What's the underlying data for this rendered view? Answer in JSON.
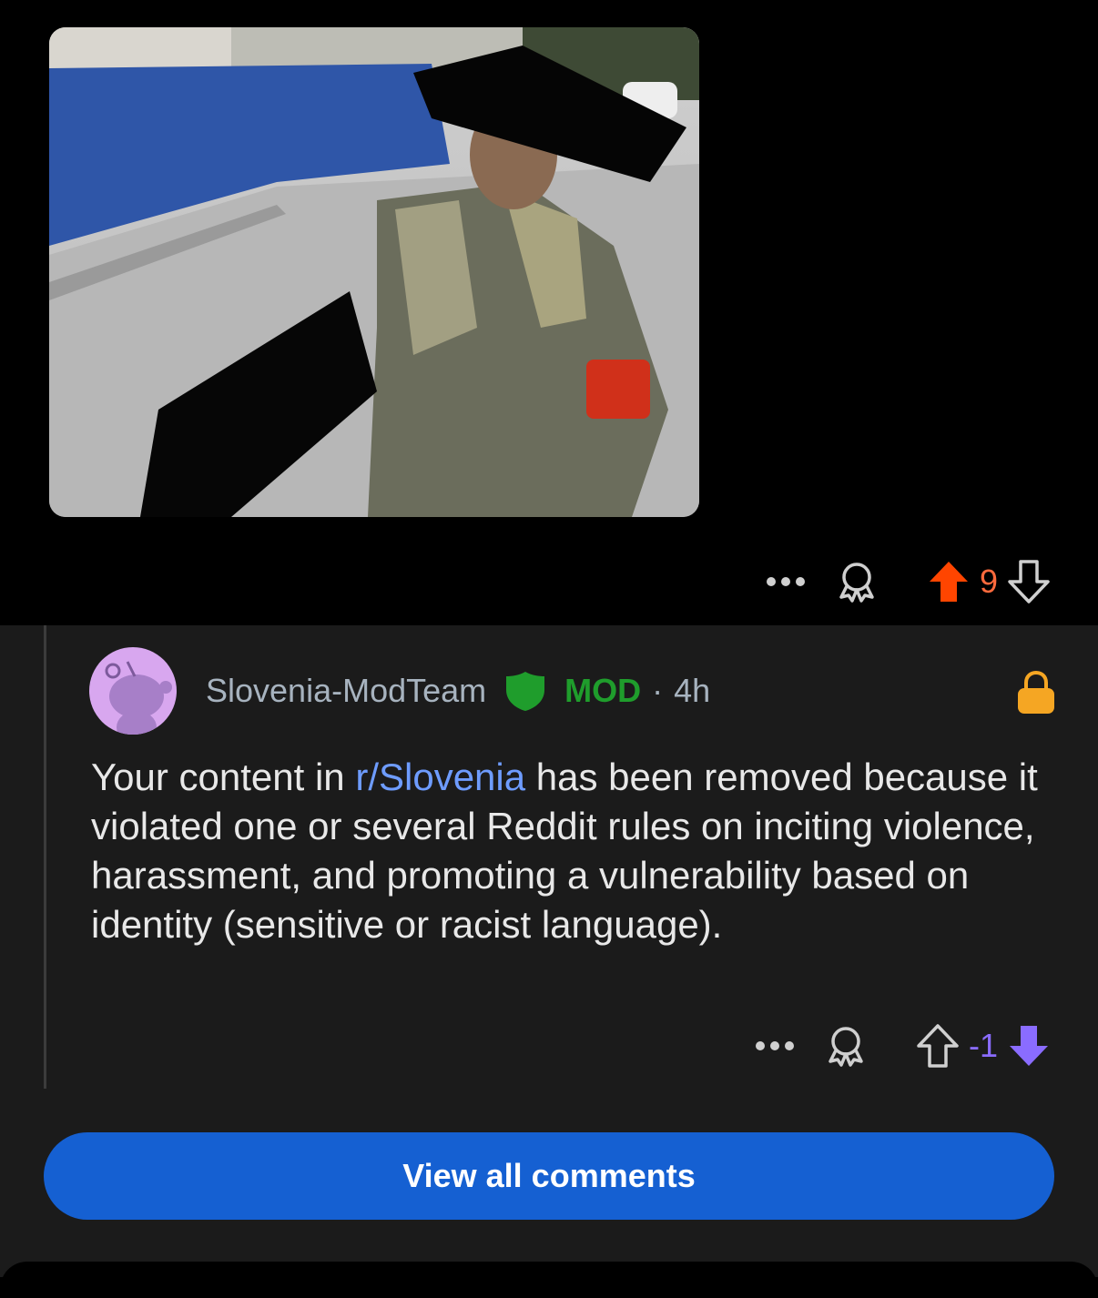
{
  "post": {
    "score": "9",
    "more_icon": "more-dots-icon",
    "award_icon": "award-icon",
    "upvote_icon": "upvote-filled-icon",
    "downvote_icon": "downvote-outline-icon",
    "colors": {
      "upvote": "#ff4500",
      "score": "#ff6a3d"
    }
  },
  "comment": {
    "username": "Slovenia-ModTeam",
    "mod_label": "MOD",
    "separator": "·",
    "time": "4h",
    "body_before": "Your content in ",
    "body_link": "r/Slovenia",
    "body_after": " has been removed because it violated one or several Reddit rules on inciting violence, harassment, and promoting a vulnerability based on identity (sensitive or racist language).",
    "score": "-1",
    "colors": {
      "mod": "#1f9d2c",
      "lock": "#f5a623",
      "downvote": "#8a6cff",
      "link": "#6e9cff"
    }
  },
  "footer": {
    "view_all_label": "View all comments",
    "button_color": "#1560d2"
  }
}
